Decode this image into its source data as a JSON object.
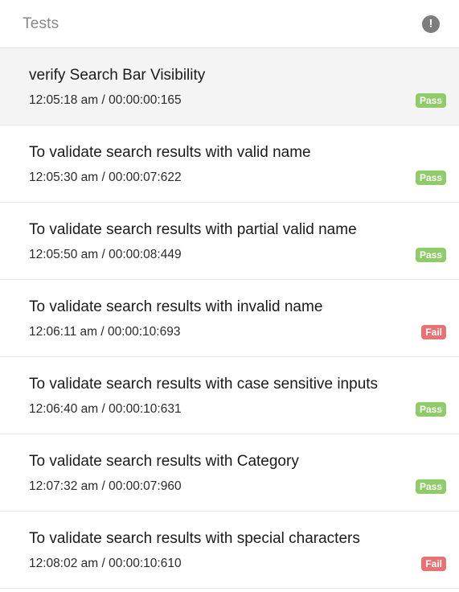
{
  "header": {
    "title": "Tests",
    "alert_icon_glyph": "!"
  },
  "colors": {
    "pass": "#8fcc69",
    "fail": "#e57373"
  },
  "tests": [
    {
      "name": "verify Search Bar Visibility",
      "time": "12:05:18 am / 00:00:00:165",
      "status": "Pass"
    },
    {
      "name": "To validate search results with valid name",
      "time": "12:05:30 am / 00:00:07:622",
      "status": "Pass"
    },
    {
      "name": "To validate search results with partial valid name",
      "time": "12:05:50 am / 00:00:08:449",
      "status": "Pass"
    },
    {
      "name": "To validate search results with invalid name",
      "time": "12:06:11 am / 00:00:10:693",
      "status": "Fail"
    },
    {
      "name": "To validate search results with case sensitive inputs",
      "time": "12:06:40 am / 00:00:10:631",
      "status": "Pass"
    },
    {
      "name": "To validate search results with Category",
      "time": "12:07:32 am / 00:00:07:960",
      "status": "Pass"
    },
    {
      "name": "To validate search results with special characters",
      "time": "12:08:02 am / 00:00:10:610",
      "status": "Fail"
    }
  ]
}
